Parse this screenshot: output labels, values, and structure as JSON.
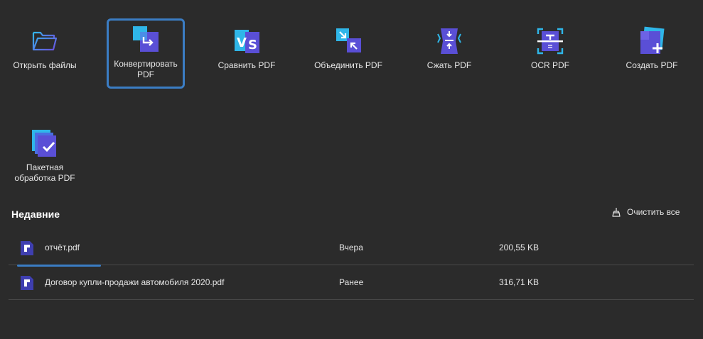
{
  "tools": [
    {
      "label": "Открыть файлы",
      "icon": "open-folder-icon"
    },
    {
      "label": "Конвертировать PDF",
      "icon": "convert-pdf-icon",
      "selected": true
    },
    {
      "label": "Сравнить PDF",
      "icon": "compare-pdf-icon"
    },
    {
      "label": "Объединить PDF",
      "icon": "merge-pdf-icon"
    },
    {
      "label": "Сжать PDF",
      "icon": "compress-pdf-icon"
    },
    {
      "label": "OCR PDF",
      "icon": "ocr-pdf-icon"
    },
    {
      "label": "Создать PDF",
      "icon": "create-pdf-icon"
    },
    {
      "label": "Пакетная обработка PDF",
      "icon": "batch-pdf-icon"
    }
  ],
  "recent": {
    "title": "Недавние",
    "clear_label": "Очистить все",
    "files": [
      {
        "name": "отчёт.pdf",
        "date": "Вчера",
        "size": "200,55 KB"
      },
      {
        "name": "Договор купли-продажи автомобиля 2020.pdf",
        "date": "Ранее",
        "size": "316,71 KB"
      }
    ]
  },
  "colors": {
    "background": "#2b2b2b",
    "accent": "#3b7dc4",
    "icon_purple": "#5a4fd6",
    "icon_cyan": "#2fb6e8"
  }
}
